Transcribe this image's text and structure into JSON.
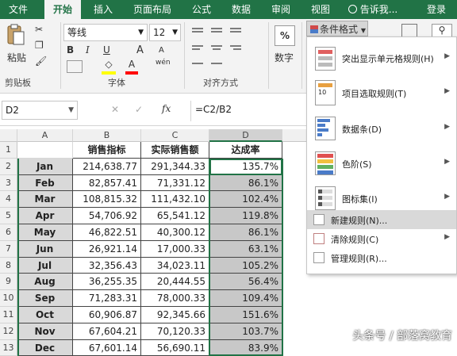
{
  "tabs": [
    "文件",
    "开始",
    "插入",
    "页面布局",
    "公式",
    "数据",
    "审阅",
    "视图"
  ],
  "tell_me": "告诉我...",
  "login": "登录",
  "ribbon": {
    "paste": "粘贴",
    "clipboard": "剪贴板",
    "font_name": "等线",
    "font_size": "12",
    "font_group": "字体",
    "align_group": "对齐方式",
    "number": "数字",
    "number_symbol": "%",
    "cond_format": "条件格式",
    "bold": "B",
    "italic": "I",
    "underline": "U",
    "grow_font": "A",
    "shrink_font": "A",
    "font_color": "A",
    "wen": "wén"
  },
  "formula_bar": {
    "name_box": "D2",
    "fx": "fx",
    "formula": "=C2/B2",
    "cancel": "✕",
    "enter": "✓"
  },
  "columns": [
    "A",
    "B",
    "C",
    "D"
  ],
  "header_row": [
    "",
    "销售指标",
    "实际销售额",
    "达成率"
  ],
  "rows": [
    {
      "n": "2",
      "month": "Jan",
      "target": "214,638.77",
      "actual": "291,344.33",
      "rate": "135.7%"
    },
    {
      "n": "3",
      "month": "Feb",
      "target": "82,857.41",
      "actual": "71,331.12",
      "rate": "86.1%"
    },
    {
      "n": "4",
      "month": "Mar",
      "target": "108,815.32",
      "actual": "111,432.10",
      "rate": "102.4%"
    },
    {
      "n": "5",
      "month": "Apr",
      "target": "54,706.92",
      "actual": "65,541.12",
      "rate": "119.8%"
    },
    {
      "n": "6",
      "month": "May",
      "target": "46,822.51",
      "actual": "40,300.12",
      "rate": "86.1%"
    },
    {
      "n": "7",
      "month": "Jun",
      "target": "26,921.14",
      "actual": "17,000.33",
      "rate": "63.1%"
    },
    {
      "n": "8",
      "month": "Jul",
      "target": "32,356.43",
      "actual": "34,023.11",
      "rate": "105.2%"
    },
    {
      "n": "9",
      "month": "Aug",
      "target": "36,255.35",
      "actual": "20,444.55",
      "rate": "56.4%"
    },
    {
      "n": "10",
      "month": "Sep",
      "target": "71,283.31",
      "actual": "78,000.33",
      "rate": "109.4%"
    },
    {
      "n": "11",
      "month": "Oct",
      "target": "60,906.87",
      "actual": "92,345.66",
      "rate": "151.6%"
    },
    {
      "n": "12",
      "month": "Nov",
      "target": "67,604.21",
      "actual": "70,120.33",
      "rate": "103.7%"
    },
    {
      "n": "13",
      "month": "Dec",
      "target": "67,601.14",
      "actual": "56,690.11",
      "rate": "83.9%"
    }
  ],
  "menu": {
    "items": [
      {
        "label": "突出显示单元格规则(H)",
        "icon": "highlight-cells-icon"
      },
      {
        "label": "项目选取规则(T)",
        "icon": "top-bottom-rules-icon"
      },
      {
        "label": "数据条(D)",
        "icon": "data-bars-icon"
      },
      {
        "label": "色阶(S)",
        "icon": "color-scales-icon"
      },
      {
        "label": "图标集(I)",
        "icon": "icon-sets-icon"
      }
    ],
    "new_rule": "新建规则(N)...",
    "clear_rules": "清除规则(C)",
    "manage_rules": "管理规则(R)..."
  },
  "watermark": "头条号 / 部落窝教育",
  "colors": {
    "excel_green": "#217346",
    "selection_green": "#217346",
    "month_fill": "#d9d9d9"
  }
}
